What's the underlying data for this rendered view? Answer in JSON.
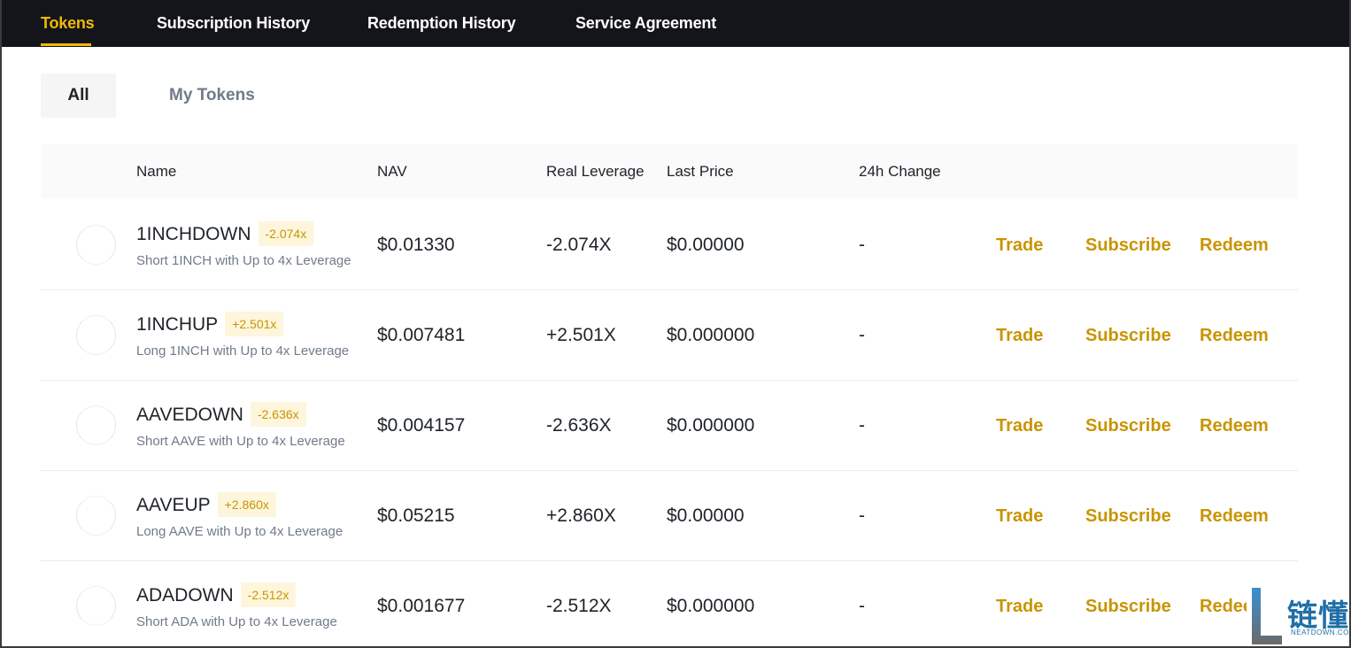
{
  "nav": {
    "tabs": [
      {
        "label": "Tokens",
        "active": true
      },
      {
        "label": "Subscription History",
        "active": false
      },
      {
        "label": "Redemption History",
        "active": false
      },
      {
        "label": "Service Agreement",
        "active": false
      }
    ]
  },
  "filters": {
    "all_label": "All",
    "mine_label": "My Tokens",
    "selected": "All"
  },
  "table": {
    "columns": [
      "Name",
      "NAV",
      "Real Leverage",
      "Last Price",
      "24h Change"
    ],
    "actions": {
      "trade": "Trade",
      "subscribe": "Subscribe",
      "redeem": "Redeem"
    },
    "rows": [
      {
        "name": "1INCHDOWN",
        "badge": "-2.074x",
        "desc": "Short 1INCH with Up to 4x Leverage",
        "nav": "$0.01330",
        "leverage": "-2.074X",
        "last_price": "$0.00000",
        "change": "-"
      },
      {
        "name": "1INCHUP",
        "badge": "+2.501x",
        "desc": "Long 1INCH with Up to 4x Leverage",
        "nav": "$0.007481",
        "leverage": "+2.501X",
        "last_price": "$0.000000",
        "change": "-"
      },
      {
        "name": "AAVEDOWN",
        "badge": "-2.636x",
        "desc": "Short AAVE with Up to 4x Leverage",
        "nav": "$0.004157",
        "leverage": "-2.636X",
        "last_price": "$0.000000",
        "change": "-"
      },
      {
        "name": "AAVEUP",
        "badge": "+2.860x",
        "desc": "Long AAVE with Up to 4x Leverage",
        "nav": "$0.05215",
        "leverage": "+2.860X",
        "last_price": "$0.00000",
        "change": "-"
      },
      {
        "name": "ADADOWN",
        "badge": "-2.512x",
        "desc": "Short ADA with Up to 4x Leverage",
        "nav": "$0.001677",
        "leverage": "-2.512X",
        "last_price": "$0.000000",
        "change": "-"
      }
    ]
  },
  "watermark": {
    "cn": "链懂",
    "en": "NEATDOWN.COM"
  },
  "colors": {
    "accent": "#f0b90b",
    "action": "#c99400",
    "nav_bg": "#14151a",
    "muted": "#707a8a"
  }
}
